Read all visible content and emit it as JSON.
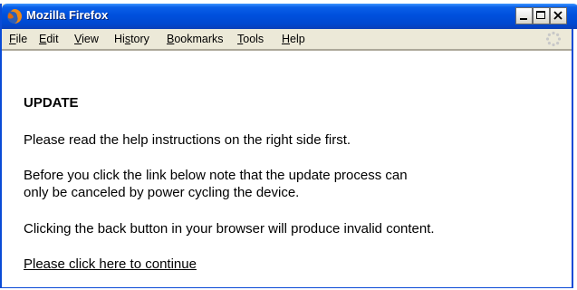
{
  "window": {
    "title": "Mozilla Firefox"
  },
  "menu": {
    "items": [
      {
        "pre": "",
        "key": "F",
        "post": "ile"
      },
      {
        "pre": "",
        "key": "E",
        "post": "dit"
      },
      {
        "pre": "",
        "key": "V",
        "post": "iew"
      },
      {
        "pre": "Hi",
        "key": "s",
        "post": "tory"
      },
      {
        "pre": "",
        "key": "B",
        "post": "ookmarks"
      },
      {
        "pre": "",
        "key": "T",
        "post": "ools"
      },
      {
        "pre": "",
        "key": "H",
        "post": "elp"
      }
    ]
  },
  "page": {
    "heading": "UPDATE",
    "para1": "Please read the help instructions on the right side first.",
    "para2_line1": "Before you click the link below note that the update process can",
    "para2_line2": "only be canceled by power cycling the device.",
    "para3": "Clicking the back button in your browser will produce invalid content.",
    "link": "Please click here to continue"
  },
  "icons": {
    "app": "firefox-icon",
    "throbber": "throbber-icon"
  }
}
